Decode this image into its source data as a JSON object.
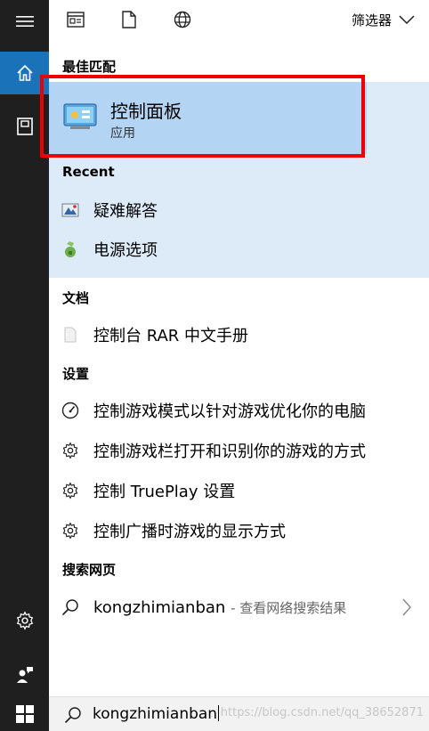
{
  "filter": {
    "label": "筛选器"
  },
  "best_match": {
    "header": "最佳匹配",
    "title": "控制面板",
    "subtitle": "应用"
  },
  "recent": {
    "header": "Recent",
    "items": [
      {
        "label": "疑难解答",
        "icon": "troubleshoot-icon"
      },
      {
        "label": "电源选项",
        "icon": "power-options-icon"
      }
    ]
  },
  "documents": {
    "header": "文档",
    "items": [
      {
        "label": "控制台 RAR 中文手册",
        "icon": "document-icon"
      }
    ]
  },
  "settings": {
    "header": "设置",
    "items": [
      {
        "label": "控制游戏模式以针对游戏优化你的电脑",
        "icon": "gauge-icon"
      },
      {
        "label": "控制游戏栏打开和识别你的游戏的方式",
        "icon": "gear-icon"
      },
      {
        "label": "控制 TruePlay 设置",
        "icon": "gear-icon"
      },
      {
        "label": "控制广播时游戏的显示方式",
        "icon": "gear-icon"
      }
    ]
  },
  "web": {
    "header": "搜索网页",
    "query": "kongzhimianban",
    "suffix": "- 查看网络搜索结果"
  },
  "search": {
    "value": "kongzhimianban",
    "watermark": "https://blog.csdn.net/qq_38652871"
  },
  "colors": {
    "sidebar": "#1f1f1f",
    "accent": "#1a73b8",
    "highlight": "#b3d5f3",
    "panel": "#ddeaf7",
    "red_box": "#ee0000"
  }
}
